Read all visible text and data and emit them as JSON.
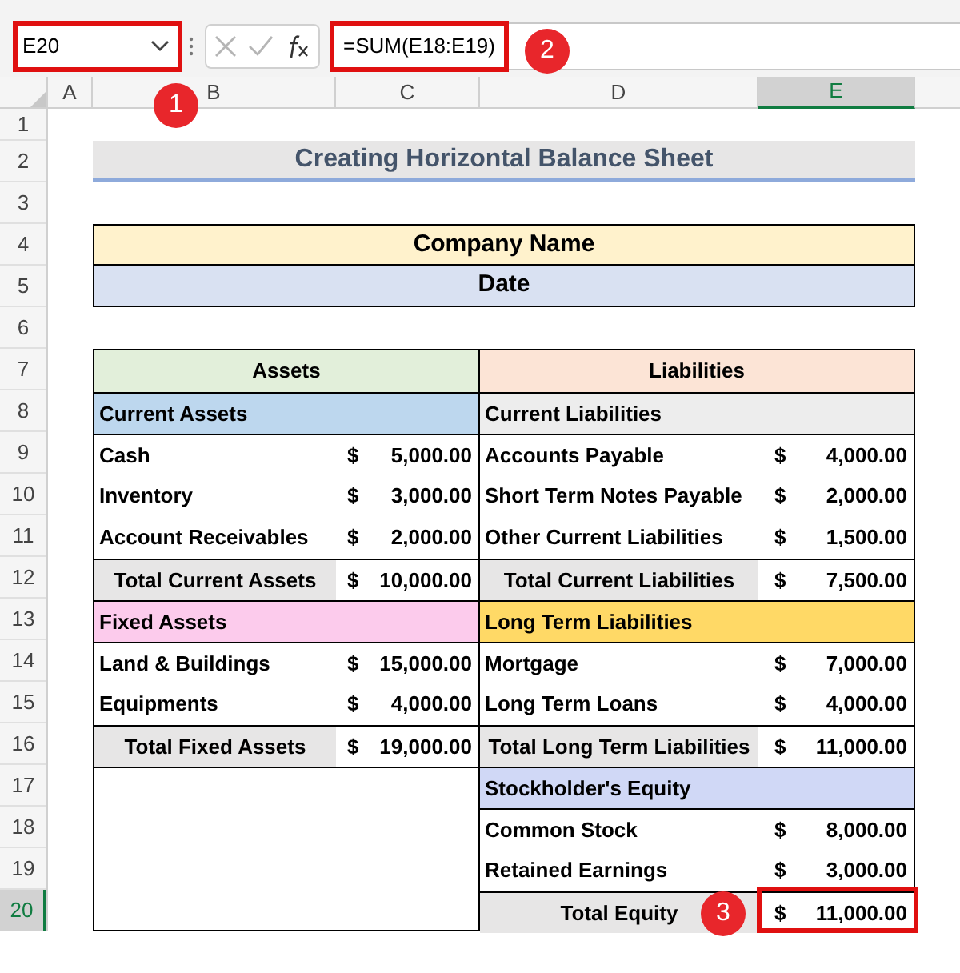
{
  "name_box": {
    "value": "E20"
  },
  "formula_bar": {
    "formula": "=SUM(E18:E19)"
  },
  "callouts": [
    {
      "label": "1"
    },
    {
      "label": "2"
    },
    {
      "label": "3"
    }
  ],
  "column_headers": [
    {
      "label": "A",
      "selected": false
    },
    {
      "label": "B",
      "selected": false
    },
    {
      "label": "C",
      "selected": false
    },
    {
      "label": "D",
      "selected": false
    },
    {
      "label": "E",
      "selected": true
    }
  ],
  "row_headers": [
    {
      "label": "1",
      "selected": false
    },
    {
      "label": "2",
      "selected": false
    },
    {
      "label": "3",
      "selected": false
    },
    {
      "label": "4",
      "selected": false
    },
    {
      "label": "5",
      "selected": false
    },
    {
      "label": "6",
      "selected": false
    },
    {
      "label": "7",
      "selected": false
    },
    {
      "label": "8",
      "selected": false
    },
    {
      "label": "9",
      "selected": false
    },
    {
      "label": "10",
      "selected": false
    },
    {
      "label": "11",
      "selected": false
    },
    {
      "label": "12",
      "selected": false
    },
    {
      "label": "13",
      "selected": false
    },
    {
      "label": "14",
      "selected": false
    },
    {
      "label": "15",
      "selected": false
    },
    {
      "label": "16",
      "selected": false
    },
    {
      "label": "17",
      "selected": false
    },
    {
      "label": "18",
      "selected": false
    },
    {
      "label": "19",
      "selected": false
    },
    {
      "label": "20",
      "selected": true
    }
  ],
  "title": "Creating Horizontal Balance Sheet",
  "company_name": "Company Name",
  "date": "Date",
  "assets": {
    "header": "Assets",
    "rows": [
      {
        "kind": "section",
        "label": "Current Assets",
        "color": "#bdd7ee"
      },
      {
        "kind": "item",
        "label": "Cash",
        "currency": "$",
        "amount": "5,000.00"
      },
      {
        "kind": "item",
        "label": "Inventory",
        "currency": "$",
        "amount": "3,000.00"
      },
      {
        "kind": "item",
        "label": "Account Receivables",
        "currency": "$",
        "amount": "2,000.00"
      },
      {
        "kind": "total",
        "label": "Total Current Assets",
        "currency": "$",
        "amount": "10,000.00"
      },
      {
        "kind": "section",
        "label": "Fixed Assets",
        "color": "#fccbec"
      },
      {
        "kind": "item",
        "label": "Land & Buildings",
        "currency": "$",
        "amount": "15,000.00"
      },
      {
        "kind": "item",
        "label": "Equipments",
        "currency": "$",
        "amount": "4,000.00"
      },
      {
        "kind": "total",
        "label": "Total Fixed Assets",
        "currency": "$",
        "amount": "19,000.00"
      }
    ]
  },
  "liabilities": {
    "header": "Liabilities",
    "rows": [
      {
        "kind": "section",
        "label": "Current Liabilities",
        "color": "#ededed"
      },
      {
        "kind": "item",
        "label": "Accounts Payable",
        "currency": "$",
        "amount": "4,000.00"
      },
      {
        "kind": "item",
        "label": "Short Term Notes Payable",
        "currency": "$",
        "amount": "2,000.00"
      },
      {
        "kind": "item",
        "label": "Other Current Liabilities",
        "currency": "$",
        "amount": "1,500.00"
      },
      {
        "kind": "total",
        "label": "Total Current Liabilities",
        "currency": "$",
        "amount": "7,500.00"
      },
      {
        "kind": "section",
        "label": "Long Term Liabilities",
        "color": "#ffd966"
      },
      {
        "kind": "item",
        "label": "Mortgage",
        "currency": "$",
        "amount": "7,000.00"
      },
      {
        "kind": "item",
        "label": "Long Term Loans",
        "currency": "$",
        "amount": "4,000.00"
      },
      {
        "kind": "total",
        "label": "Total Long Term Liabilities",
        "currency": "$",
        "amount": "11,000.00"
      },
      {
        "kind": "section",
        "label": "Stockholder's Equity",
        "color": "#d0d8f6"
      },
      {
        "kind": "item",
        "label": "Common Stock",
        "currency": "$",
        "amount": "8,000.00"
      },
      {
        "kind": "item",
        "label": "Retained Earnings",
        "currency": "$",
        "amount": "3,000.00"
      },
      {
        "kind": "total",
        "label": "Total Equity",
        "currency": "$",
        "amount": "11,000.00"
      }
    ]
  }
}
